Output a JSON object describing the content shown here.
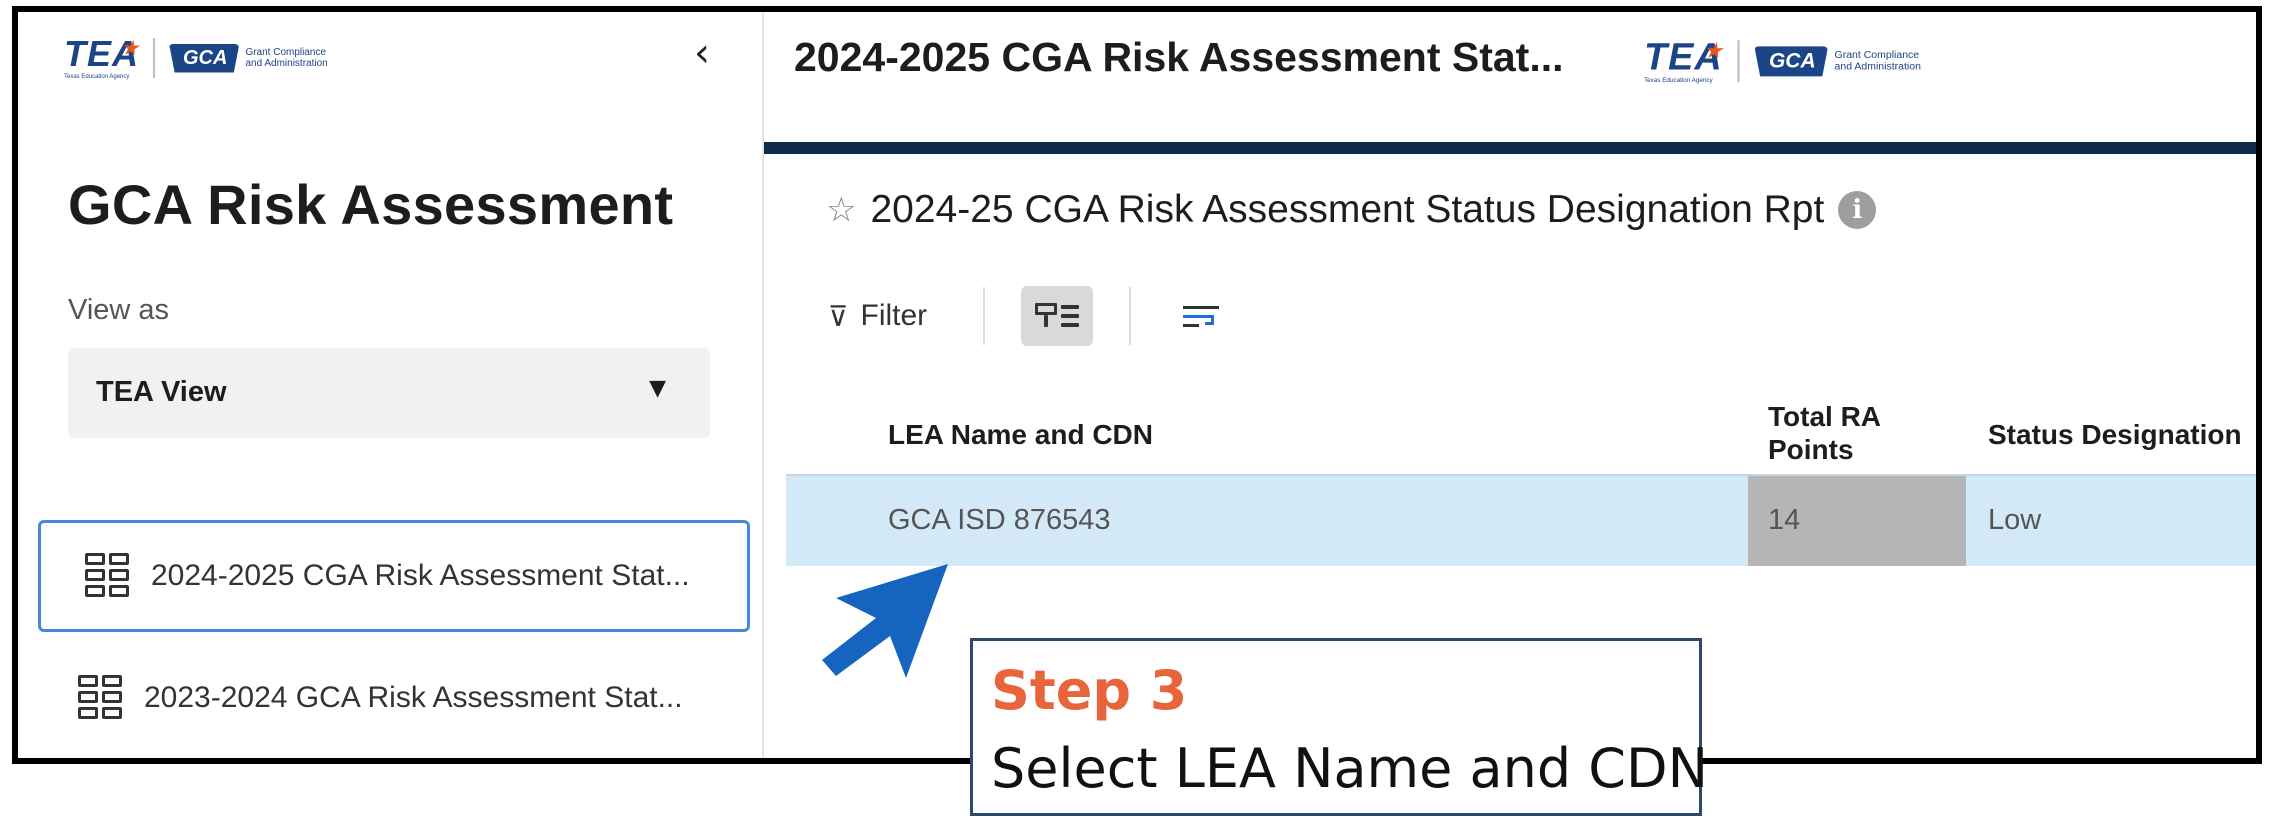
{
  "sidebar": {
    "logo_tea": "TEA",
    "logo_tea_sub": "Texas Education Agency",
    "logo_gca": "GCA",
    "logo_gca_text_1": "Grant Compliance",
    "logo_gca_text_2": "and Administration",
    "collapse_icon": "chevron-left-icon",
    "title": "GCA Risk Assessment",
    "view_as_label": "View as",
    "view_as_value": "TEA View",
    "items": [
      {
        "label": "2024-2025 CGA Risk Assessment Stat...",
        "icon": "grid-icon",
        "active": true
      },
      {
        "label": "2023-2024 GCA Risk Assessment Stat...",
        "icon": "grid-icon",
        "active": false
      }
    ]
  },
  "header": {
    "title": "2024-2025 CGA Risk Assessment Stat..."
  },
  "report": {
    "title": "2024-25 CGA Risk Assessment Status Designation Rpt",
    "toolbar": {
      "filter_label": "Filter"
    },
    "columns": [
      "LEA Name and CDN",
      "Total RA Points",
      "Status Designation"
    ],
    "column_lines": {
      "total_ra_1": "Total RA",
      "total_ra_2": "Points"
    },
    "rows": [
      {
        "lea": "GCA ISD 876543",
        "points": "14",
        "status": "Low"
      }
    ]
  },
  "annotation": {
    "step": "Step 3",
    "text": "Select LEA Name and CDN",
    "arrow_color": "#1565c0",
    "step_color": "#e8643a"
  },
  "colors": {
    "header_rule": "#0f2a4a",
    "selected_row": "#d4e9f7",
    "points_cell": "#b5b5b5",
    "active_nav_border": "#4a87d8"
  }
}
